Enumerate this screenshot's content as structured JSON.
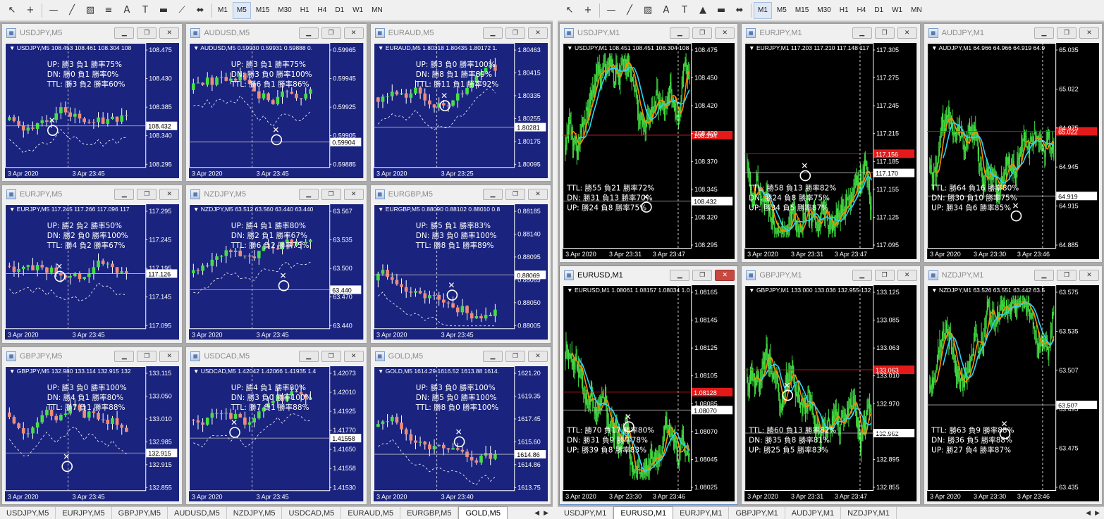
{
  "left": {
    "toolbar": {
      "timeframes": [
        "M1",
        "M5",
        "M15",
        "M30",
        "H1",
        "H4",
        "D1",
        "W1",
        "MN"
      ],
      "active_tf": "M5"
    },
    "windows": [
      {
        "title": "USDJPY,M5",
        "active": false,
        "header": "USDJPY,M5  108.453 108.461 108.304 108",
        "axis": [
          "108.475",
          "108.430",
          "108.385",
          "108.340",
          "108.295"
        ],
        "price": "108.432",
        "dates": [
          "3 Apr 2020",
          "3 Apr 23:45"
        ],
        "stats": [
          "UP: 勝3 負1 勝率75%",
          "DN: 勝0 負1 勝率0%",
          "TTL: 勝3 負2 勝率60%"
        ],
        "theme": "navy",
        "seed": 11
      },
      {
        "title": "AUDUSD,M5",
        "active": false,
        "header": "AUDUSD,M5  0.59930 0.59931 0.59888 0.",
        "axis": [
          "0.59965",
          "0.59945",
          "0.59925",
          "0.59905",
          "0.59885"
        ],
        "price": "0.59904",
        "dates": [
          "3 Apr 2020",
          "3 Apr 23:45"
        ],
        "stats": [
          "UP: 勝3 負1 勝率75%",
          "DN: 勝3 負0 勝率100%",
          "TTL: 勝6 負1 勝率86%"
        ],
        "theme": "navy",
        "seed": 22
      },
      {
        "title": "EURAUD,M5",
        "active": false,
        "header": "EURAUD,M5  1.80318 1.80435 1.80172 1.",
        "axis": [
          "1.80463",
          "1.80415",
          "1.80335",
          "1.80255",
          "1.80175",
          "1.80095"
        ],
        "price": "1.80281",
        "dates": [
          "3 Apr 2020",
          "3 Apr 23:25"
        ],
        "stats": [
          "UP: 勝3 負0 勝率100%",
          "DN: 勝8 負1 勝率89%",
          "TTL: 勝11 負1 勝率92%"
        ],
        "theme": "navy",
        "seed": 33
      },
      {
        "title": "EURJPY,M5",
        "active": false,
        "header": "EURJPY,M5  117.245 117.266 117.096 117",
        "axis": [
          "117.295",
          "117.245",
          "117.195",
          "117.145",
          "117.095"
        ],
        "price": "117.126",
        "dates": [
          "3 Apr 2020",
          "3 Apr 23:45"
        ],
        "stats": [
          "UP: 勝2 負2 勝率50%",
          "DN: 勝2 負0 勝率100%",
          "TTL: 勝4 負2 勝率67%"
        ],
        "theme": "navy",
        "seed": 44
      },
      {
        "title": "NZDJPY,M5",
        "active": false,
        "header": "NZDJPY,M5  63.512 63.560 63.440 63.440",
        "axis": [
          "63.567",
          "63.535",
          "63.500",
          "63.470",
          "63.440"
        ],
        "price": "63.440",
        "dates": [
          "3 Apr 2020",
          "3 Apr 23:45"
        ],
        "stats": [
          "UP: 勝4 負1 勝率80%",
          "DN: 勝2 負1 勝率67%",
          "TTL: 勝6 負2 勝率75%"
        ],
        "theme": "navy",
        "seed": 55
      },
      {
        "title": "EURGBP,M5",
        "active": false,
        "header": "EURGBP,M5  0.88090 0.88102 0.88010 0.8",
        "axis": [
          "0.88185",
          "0.88140",
          "0.88095",
          "0.88069",
          "0.88050",
          "0.88005"
        ],
        "price": "0.88069",
        "dates": [
          "3 Apr 2020",
          "3 Apr 23:45"
        ],
        "stats": [
          "UP: 勝5 負1 勝率83%",
          "DN: 勝3 負0 勝率100%",
          "TTL: 勝8 負1 勝率89%"
        ],
        "theme": "navy",
        "seed": 66
      },
      {
        "title": "GBPJPY,M5",
        "active": false,
        "header": "GBPJPY,M5  132.980 133.114 132.915 132",
        "axis": [
          "133.115",
          "133.050",
          "133.010",
          "132.985",
          "132.915",
          "132.855"
        ],
        "price": "132.915",
        "dates": [
          "3 Apr 2020",
          "3 Apr 23:45"
        ],
        "stats": [
          "UP: 勝3 負0 勝率100%",
          "DN: 勝4 負1 勝率80%",
          "TTL: 勝7 負1 勝率88%"
        ],
        "theme": "navy",
        "seed": 77
      },
      {
        "title": "USDCAD,M5",
        "active": false,
        "header": "USDCAD,M5  1.42042 1.42066 1.41935 1.4",
        "axis": [
          "1.42073",
          "1.42010",
          "1.41925",
          "1.41770",
          "1.41650",
          "1.41558",
          "1.41530"
        ],
        "price": "1.41558",
        "dates": [
          "3 Apr 2020",
          "3 Apr 23:45"
        ],
        "stats": [
          "UP: 勝4 負1 勝率80%",
          "DN: 勝3 負0 勝率100%",
          "TTL: 勝7 負1 勝率88%"
        ],
        "theme": "navy",
        "seed": 88
      },
      {
        "title": "GOLD,M5",
        "active": false,
        "header": "GOLD,M5  1614.29 1616.52 1613.88 1614.",
        "axis": [
          "1621.20",
          "1619.35",
          "1617.45",
          "1615.60",
          "1614.86",
          "1613.75"
        ],
        "price": "1614.86",
        "dates": [
          "3 Apr 2020",
          "3 Apr 23:40"
        ],
        "stats": [
          "UP: 勝3 負0 勝率100%",
          "DN: 勝5 負0 勝率100%",
          "TTL: 勝8 負0 勝率100%"
        ],
        "theme": "navy",
        "seed": 99
      }
    ],
    "tabs": [
      "USDJPY,M5",
      "EURJPY,M5",
      "GBPJPY,M5",
      "AUDUSD,M5",
      "NZDJPY,M5",
      "USDCAD,M5",
      "EURAUD,M5",
      "EURGBP,M5",
      "GOLD,M5"
    ],
    "active_tab": "GOLD,M5"
  },
  "right": {
    "toolbar": {
      "timeframes": [
        "M1",
        "M5",
        "M15",
        "M30",
        "H1",
        "H4",
        "D1",
        "W1",
        "MN"
      ],
      "active_tf": "M1"
    },
    "windows": [
      {
        "title": "USDJPY,M1",
        "active": false,
        "header": "USDJPY,M1  108.451 108.451 108.304 108",
        "axis": [
          "108.475",
          "108.450",
          "108.420",
          "108.400",
          "108.370",
          "108.345",
          "108.320",
          "108.295"
        ],
        "price": "108.432",
        "red_price": "108.394",
        "dates": [
          "3 Apr 2020",
          "3 Apr 23:31",
          "3 Apr 23:47"
        ],
        "stats": [
          "TTL: 勝55 負21 勝率72%",
          "DN: 勝31 負13 勝率70%",
          "UP: 勝24 負8 勝率75%"
        ],
        "theme": "black",
        "seed": 111
      },
      {
        "title": "EURJPY,M1",
        "active": false,
        "header": "EURJPY,M1  117.203 117.210 117.148 117",
        "axis": [
          "117.305",
          "117.275",
          "117.245",
          "117.215",
          "117.185",
          "117.155",
          "117.125",
          "117.095"
        ],
        "price": "117.170",
        "red_price": "117.156",
        "dates": [
          "3 Apr 2020",
          "3 Apr 23:31",
          "3 Apr 23:47"
        ],
        "stats": [
          "TTL: 勝58 負13 勝率82%",
          "DN: 勝24 負8 勝率75%",
          "UP: 勝34 負5 勝率87%"
        ],
        "theme": "black",
        "seed": 122
      },
      {
        "title": "AUDJPY,M1",
        "active": false,
        "header": "AUDJPY,M1  64.966 64.966 64.919 64.9",
        "axis": [
          "65.035",
          "65.022",
          "64.975",
          "64.945",
          "64.915",
          "64.885"
        ],
        "price": "64.919",
        "red_price": "65.022",
        "dates": [
          "3 Apr 2020",
          "3 Apr 23:30",
          "3 Apr 23:46"
        ],
        "stats": [
          "TTL: 勝64 負16 勝率80%",
          "DN: 勝30 負10 勝率75%",
          "UP: 勝34 負6 勝率85%"
        ],
        "theme": "black",
        "seed": 133
      },
      {
        "title": "EURUSD,M1",
        "active": true,
        "header": "EURUSD,M1  1.08061 1.08157 1.08034 1.0",
        "axis": [
          "1.08165",
          "1.08145",
          "1.08125",
          "1.08105",
          "1.08085",
          "1.08070",
          "1.08045",
          "1.08025"
        ],
        "price": "1.08070",
        "red_price": "1.08128",
        "dates": [
          "3 Apr 2020",
          "3 Apr 23:30",
          "3 Apr 23:46"
        ],
        "stats": [
          "TTL: 勝70 負17 勝率80%",
          "DN: 勝31 負9 勝率78%",
          "UP: 勝39 負8 勝率83%"
        ],
        "theme": "black",
        "seed": 144
      },
      {
        "title": "GBPJPY,M1",
        "active": false,
        "header": "GBPJPY,M1  133.000 133.036 132.955 132",
        "axis": [
          "133.125",
          "133.085",
          "133.063",
          "133.010",
          "132.970",
          "132.935",
          "132.895",
          "132.855"
        ],
        "price": "132.962",
        "red_price": "133.063",
        "dates": [
          "3 Apr 2020",
          "3 Apr 23:31",
          "3 Apr 23:47"
        ],
        "stats": [
          "TTL: 勝60 負13 勝率82%",
          "DN: 勝35 負8 勝率81%",
          "UP: 勝25 負5 勝率83%"
        ],
        "theme": "black",
        "seed": 155
      },
      {
        "title": "NZDJPY,M1",
        "active": false,
        "header": "NZDJPY,M1  63.526 63.551 63.442 63.5",
        "axis": [
          "63.575",
          "63.535",
          "63.507",
          "63.495",
          "63.475",
          "63.435"
        ],
        "price": "63.507",
        "red_price": "",
        "dates": [
          "3 Apr 2020",
          "3 Apr 23:30",
          "3 Apr 23:46"
        ],
        "stats": [
          "TTL: 勝63 負9 勝率88%",
          "DN: 勝36 負5 勝率88%",
          "UP: 勝27 負4 勝率87%"
        ],
        "theme": "black",
        "seed": 166
      }
    ],
    "tabs": [
      "USDJPY,M1",
      "EURUSD,M1",
      "EURJPY,M1",
      "GBPJPY,M1",
      "AUDJPY,M1",
      "NZDJPY,M1"
    ],
    "active_tab": "EURUSD,M1"
  },
  "colors": {
    "navy_bg": "#1a237e",
    "black_bg": "#000000",
    "bull": "#43e043",
    "bear": "#f08a7a",
    "price_red": "#e41a1a"
  },
  "icons": [
    "cursor-icon",
    "crosshair-icon",
    "hline-icon",
    "trendline-icon",
    "channel-icon",
    "fib-icon",
    "text-icon",
    "label-icon",
    "rect-icon",
    "gann-icon",
    "arrow-icon"
  ]
}
